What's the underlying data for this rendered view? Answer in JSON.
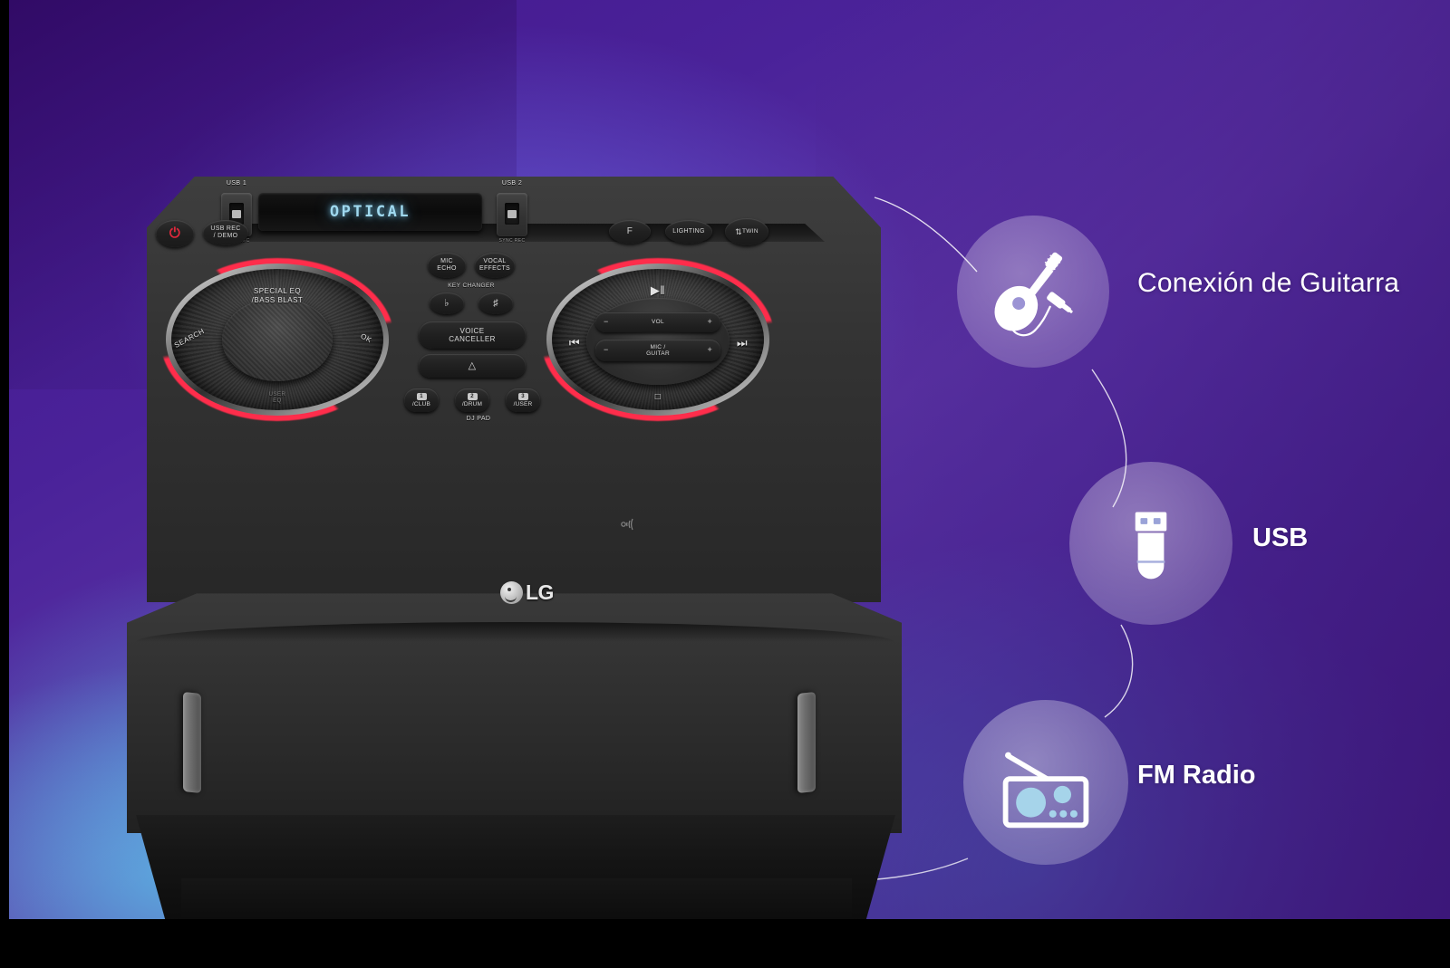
{
  "background": {
    "accent_purple": "#4a2299",
    "accent_violet": "#5c35a6",
    "accent_cyan": "#5fcdf0",
    "frame_color": "#000000"
  },
  "features": [
    {
      "id": "guitar",
      "icon": "guitar-icon",
      "label": "Conexión de Guitarra"
    },
    {
      "id": "usb",
      "icon": "usb-drive-icon",
      "label": "USB"
    },
    {
      "id": "fm",
      "icon": "radio-icon",
      "label": "FM Radio"
    }
  ],
  "speaker": {
    "brand": "LG",
    "display": {
      "value": "OPTICAL"
    },
    "ports": [
      {
        "label": "USB 1",
        "sub": "SYNC REC"
      },
      {
        "label": "USB 2",
        "sub": "SYNC REC"
      }
    ],
    "top_buttons": [
      {
        "name": "power",
        "label": "⏻"
      },
      {
        "name": "usb-rec-demo",
        "label": "USB REC\n/ DEMO"
      },
      {
        "name": "f",
        "label": "F"
      },
      {
        "name": "lighting",
        "label": "LIGHTING"
      },
      {
        "name": "twin",
        "label": "TWIN"
      }
    ],
    "left_knob": {
      "top_label_1": "SPECIAL EQ",
      "top_label_2": "/BASS BLAST",
      "left_label": "SEARCH",
      "right_label": "OK",
      "bottom_label_1": "USER",
      "bottom_label_2": "EQ"
    },
    "center_cluster": {
      "mic_echo_1": "MIC",
      "mic_echo_2": "ECHO",
      "vocal_effects_1": "VOCAL",
      "vocal_effects_2": "EFFECTS",
      "key_changer": "KEY CHANGER",
      "key_flat": "♭",
      "key_sharp": "♯",
      "voice_canceller_1": "VOICE",
      "voice_canceller_2": "CANCELLER",
      "eject": "△",
      "dj_pad_title": "DJ PAD",
      "dj_pads": [
        {
          "num": "1",
          "label": "/CLUB"
        },
        {
          "num": "2",
          "label": "/DRUM"
        },
        {
          "num": "3",
          "label": "/USER"
        }
      ]
    },
    "right_knob": {
      "play_pause": "▶‖",
      "prev": "⏮",
      "next": "⏭",
      "stop": "□",
      "vol_label": "VOL",
      "mic_guitar_1": "MIC /",
      "mic_guitar_2": "GUITAR",
      "minus": "−",
      "plus": "+"
    }
  }
}
